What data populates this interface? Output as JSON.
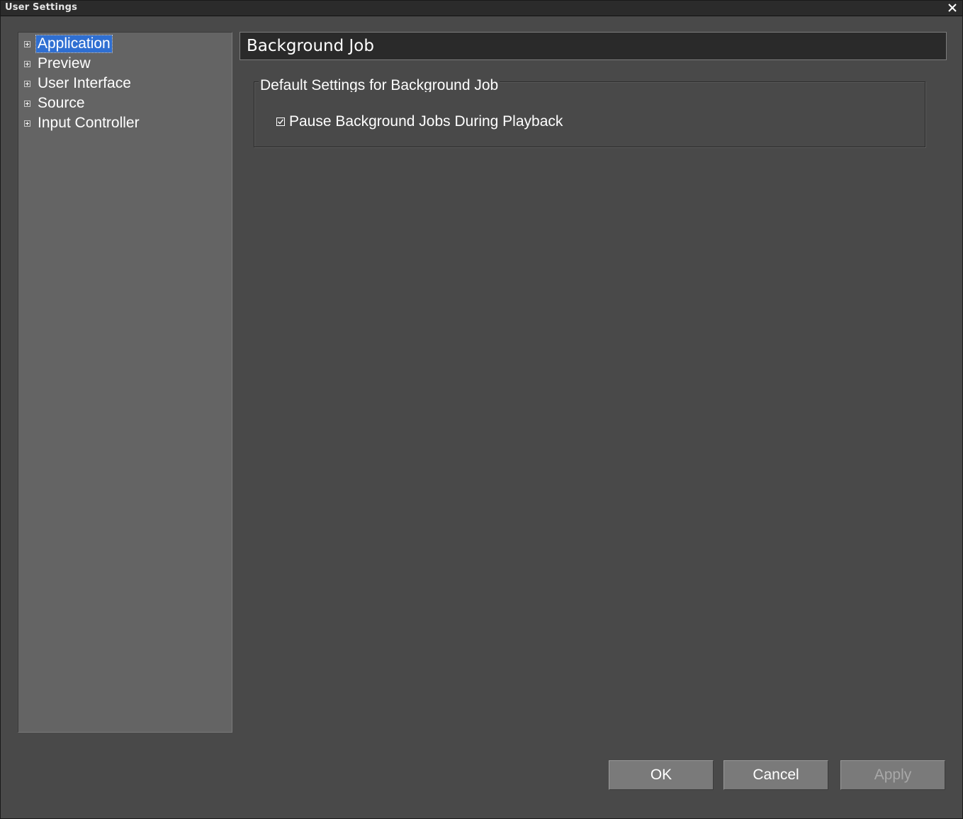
{
  "window": {
    "title": "User Settings",
    "close_icon": "close-icon"
  },
  "tree": {
    "items": [
      {
        "label": "Application",
        "selected": true,
        "icon": "expand-plus-icon"
      },
      {
        "label": "Preview",
        "selected": false,
        "icon": "expand-plus-icon"
      },
      {
        "label": "User Interface",
        "selected": false,
        "icon": "expand-plus-icon"
      },
      {
        "label": "Source",
        "selected": false,
        "icon": "expand-plus-icon"
      },
      {
        "label": "Input Controller",
        "selected": false,
        "icon": "expand-plus-icon"
      }
    ]
  },
  "section": {
    "title": "Background Job"
  },
  "group": {
    "legend": "Default Settings for Background Job",
    "checkbox": {
      "label": "Pause Background Jobs During Playback",
      "checked": true
    }
  },
  "buttons": {
    "ok": "OK",
    "cancel": "Cancel",
    "apply": "Apply",
    "apply_enabled": false
  },
  "colors": {
    "window_bg": "#494949",
    "tree_bg": "#646464",
    "header_bg": "#2a2a2a",
    "selection": "#2f6fd2",
    "button_bg": "#7a7a7a"
  }
}
